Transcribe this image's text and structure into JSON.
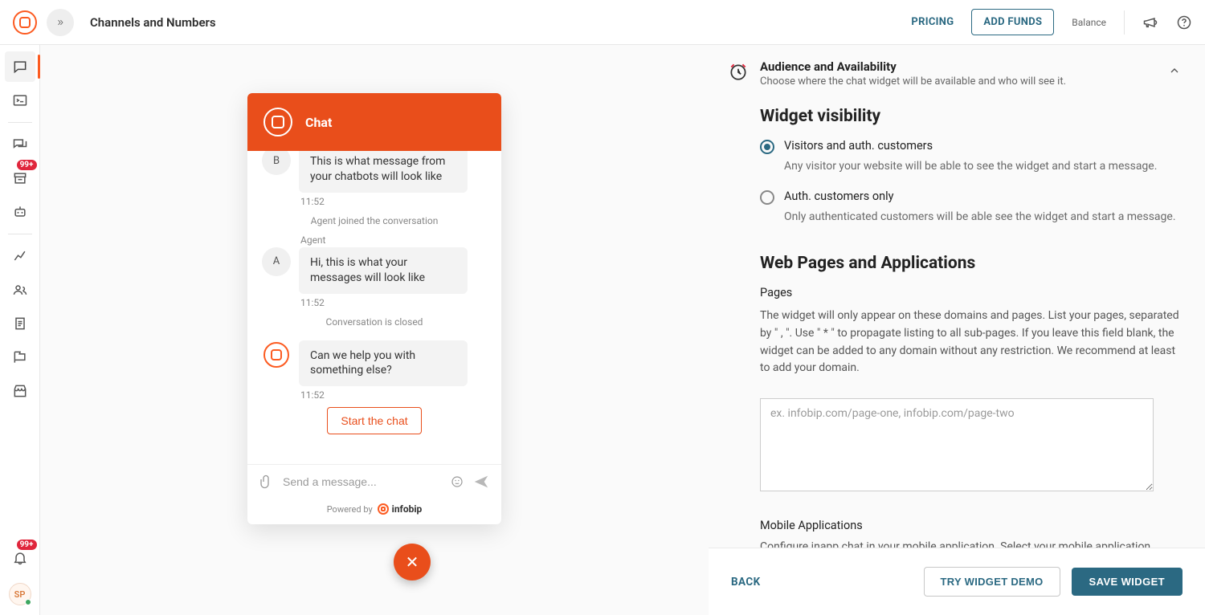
{
  "header": {
    "page_title": "Channels and Numbers",
    "pricing": "PRICING",
    "add_funds": "ADD FUNDS",
    "balance": "Balance"
  },
  "sidebar": {
    "badge1": "99+",
    "badge2": "99+",
    "user_initials": "SP"
  },
  "chat": {
    "title": "Chat",
    "bot_text": "This is what message from your chatbots will look like",
    "bot_time": "11:52",
    "agent_initial": "B",
    "joined": "Agent joined the conversation",
    "agent_label": "Agent",
    "agent_letter": "A",
    "agent_text": "Hi, this is what your messages will look like",
    "agent_time": "11:52",
    "closed": "Conversation is closed",
    "followup": "Can we help you with something else?",
    "followup_time": "11:52",
    "start_label": "Start the chat",
    "input_placeholder": "Send a message...",
    "powered_by": "Powered by",
    "brand": "infobip"
  },
  "panel": {
    "section_title": "Audience and Availability",
    "section_sub": "Choose where the chat widget will be available and who will see it.",
    "visibility_h": "Widget visibility",
    "opt1_label": "Visitors and auth. customers",
    "opt1_desc": "Any visitor your website will be able to see the widget and start a message.",
    "opt2_label": "Auth. customers only",
    "opt2_desc": "Only authenticated customers will be able see the widget and start a message.",
    "pages_h": "Web Pages and Applications",
    "pages_label": "Pages",
    "pages_desc": "The widget will only appear on these domains and pages. List your pages, separated by \" , \". Use \" * \" to propagate listing to all sub-pages. If you leave this field blank, the widget can be added to any domain without any restriction. We recommend at least to add your domain.",
    "pages_placeholder": "ex. infobip.com/page-one, infobip.com/page-two",
    "mobile_h": "Mobile Applications",
    "mobile_desc": "Configure inapp chat in your mobile application. Select your mobile application"
  },
  "footer": {
    "back": "BACK",
    "try": "TRY WIDGET DEMO",
    "save": "SAVE WIDGET"
  }
}
